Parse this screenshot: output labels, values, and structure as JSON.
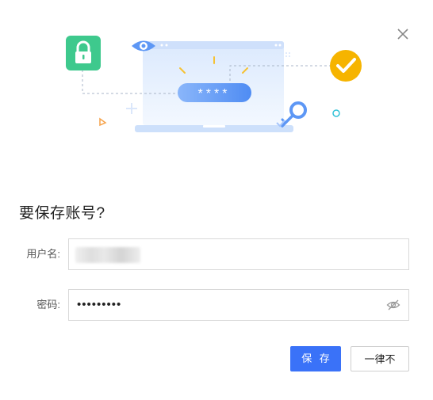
{
  "dialog": {
    "title": "要保存账号?",
    "close_icon": "close-icon"
  },
  "illustration": {
    "masked_password": "****",
    "icons": [
      "lock-icon",
      "eye-icon",
      "check-circle-icon",
      "key-icon"
    ],
    "colors": {
      "lock": "#3ec98d",
      "check": "#f6b400",
      "accent": "#5d97f5"
    }
  },
  "form": {
    "username": {
      "label": "用户名:",
      "value_obscured": true
    },
    "password": {
      "label": "密码:",
      "value": "•••••••••",
      "toggle_icon": "eye-off-icon"
    }
  },
  "actions": {
    "save_label": "保 存",
    "never_label": "一律不"
  },
  "colors": {
    "primary": "#3a72f8",
    "border": "#d9d9d9"
  }
}
